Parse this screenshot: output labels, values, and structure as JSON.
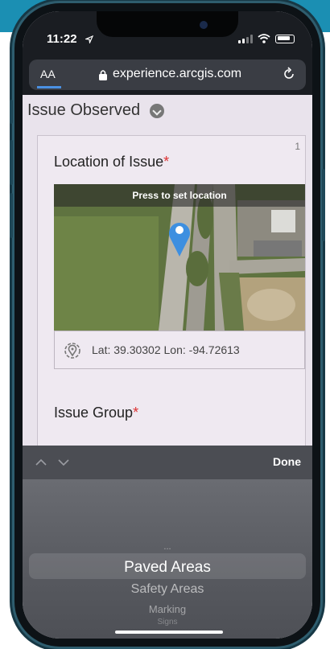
{
  "status": {
    "time": "11:22"
  },
  "browser": {
    "aa_label": "AA",
    "url": "experience.arcgis.com"
  },
  "page": {
    "section_title": "Issue Observed",
    "card_number": "1",
    "location_label": "Location of Issue",
    "required_mark": "*",
    "map_banner": "Press to set location",
    "coords": "Lat: 39.30302  Lon: -94.72613",
    "issue_group_label": "Issue Group",
    "select_value": "..."
  },
  "picker": {
    "done_label": "Done",
    "options": [
      "...",
      "Paved Areas",
      "Safety Areas",
      "Marking",
      "Signs"
    ],
    "selected": "Paved Areas"
  },
  "colors": {
    "accent": "#4a90e2",
    "required": "#dd3333",
    "pin": "#3d8fe0"
  }
}
